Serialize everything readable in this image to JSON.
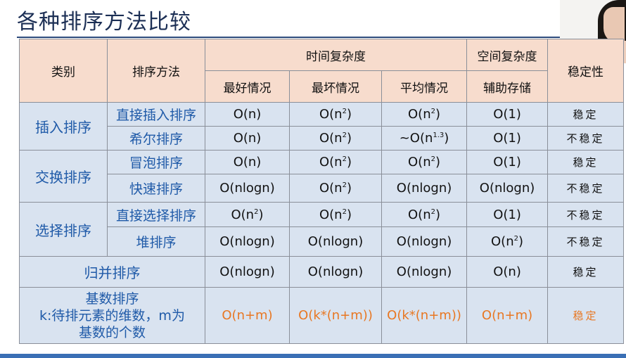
{
  "slide": {
    "title": "各种排序方法比较"
  },
  "table": {
    "headers": {
      "category": "类别",
      "method": "排序方法",
      "time_complexity": "时间复杂度",
      "space_complexity": "空间复杂度",
      "stability": "稳定性",
      "best": "最好情况",
      "worst": "最坏情况",
      "average": "平均情况",
      "auxiliary": "辅助存储"
    },
    "categories": {
      "insertion": "插入排序",
      "exchange": "交换排序",
      "selection": "选择排序",
      "merge": "归并排序",
      "radix_line1": "基数排序",
      "radix_line2": "k:待排元素的维数，m为",
      "radix_line3": "基数的个数"
    },
    "rows": {
      "direct_insertion": {
        "method": "直接插入排序",
        "best": "O(n)",
        "worst_base": "O(n",
        "worst_exp": "2",
        "avg_base": "O(n",
        "avg_exp": "2",
        "aux": "O(1)",
        "stable": "稳定"
      },
      "shell": {
        "method": "希尔排序",
        "best": "O(n)",
        "worst_base": "O(n",
        "worst_exp": "2",
        "avg_base": "~O(n",
        "avg_exp": "1.3",
        "aux": "O(1)",
        "stable": "不稳定"
      },
      "bubble": {
        "method": "冒泡排序",
        "best": "O(n)",
        "worst_base": "O(n",
        "worst_exp": "2",
        "avg_base": "O(n",
        "avg_exp": "2",
        "aux": "O(1)",
        "stable": "稳定"
      },
      "quick": {
        "method": "快速排序",
        "best": "O(nlogn)",
        "worst_base": "O(n",
        "worst_exp": "2",
        "avg": "O(nlogn)",
        "aux": "O(nlogn)",
        "stable": "不稳定"
      },
      "direct_selection": {
        "method": "直接选择排序",
        "best_base": "O(n",
        "best_exp": "2",
        "worst_base": "O(n",
        "worst_exp": "2",
        "avg_base": "O(n",
        "avg_exp": "2",
        "aux": "O(1)",
        "stable": "不稳定"
      },
      "heap": {
        "method": "堆排序",
        "best": "O(nlogn)",
        "worst": "O(nlogn)",
        "avg": "O(nlogn)",
        "aux_base": "O(n",
        "aux_exp": "2",
        "stable": "不稳定"
      },
      "merge": {
        "best": "O(nlogn)",
        "worst": "O(nlogn)",
        "avg": "O(nlogn)",
        "aux": "O(n)",
        "stable": "稳定"
      },
      "radix": {
        "best": "O(n+m)",
        "worst": "O(k*(n+m))",
        "avg": "O(k*(n+m))",
        "aux": "O(n+m)",
        "stable": "稳定"
      }
    }
  },
  "colors": {
    "header_bg": "#f7dccd",
    "body_bg": "#d9e3f0",
    "method_text": "#1f5aa8",
    "highlight": "#e87722",
    "title": "#1c2f55"
  }
}
